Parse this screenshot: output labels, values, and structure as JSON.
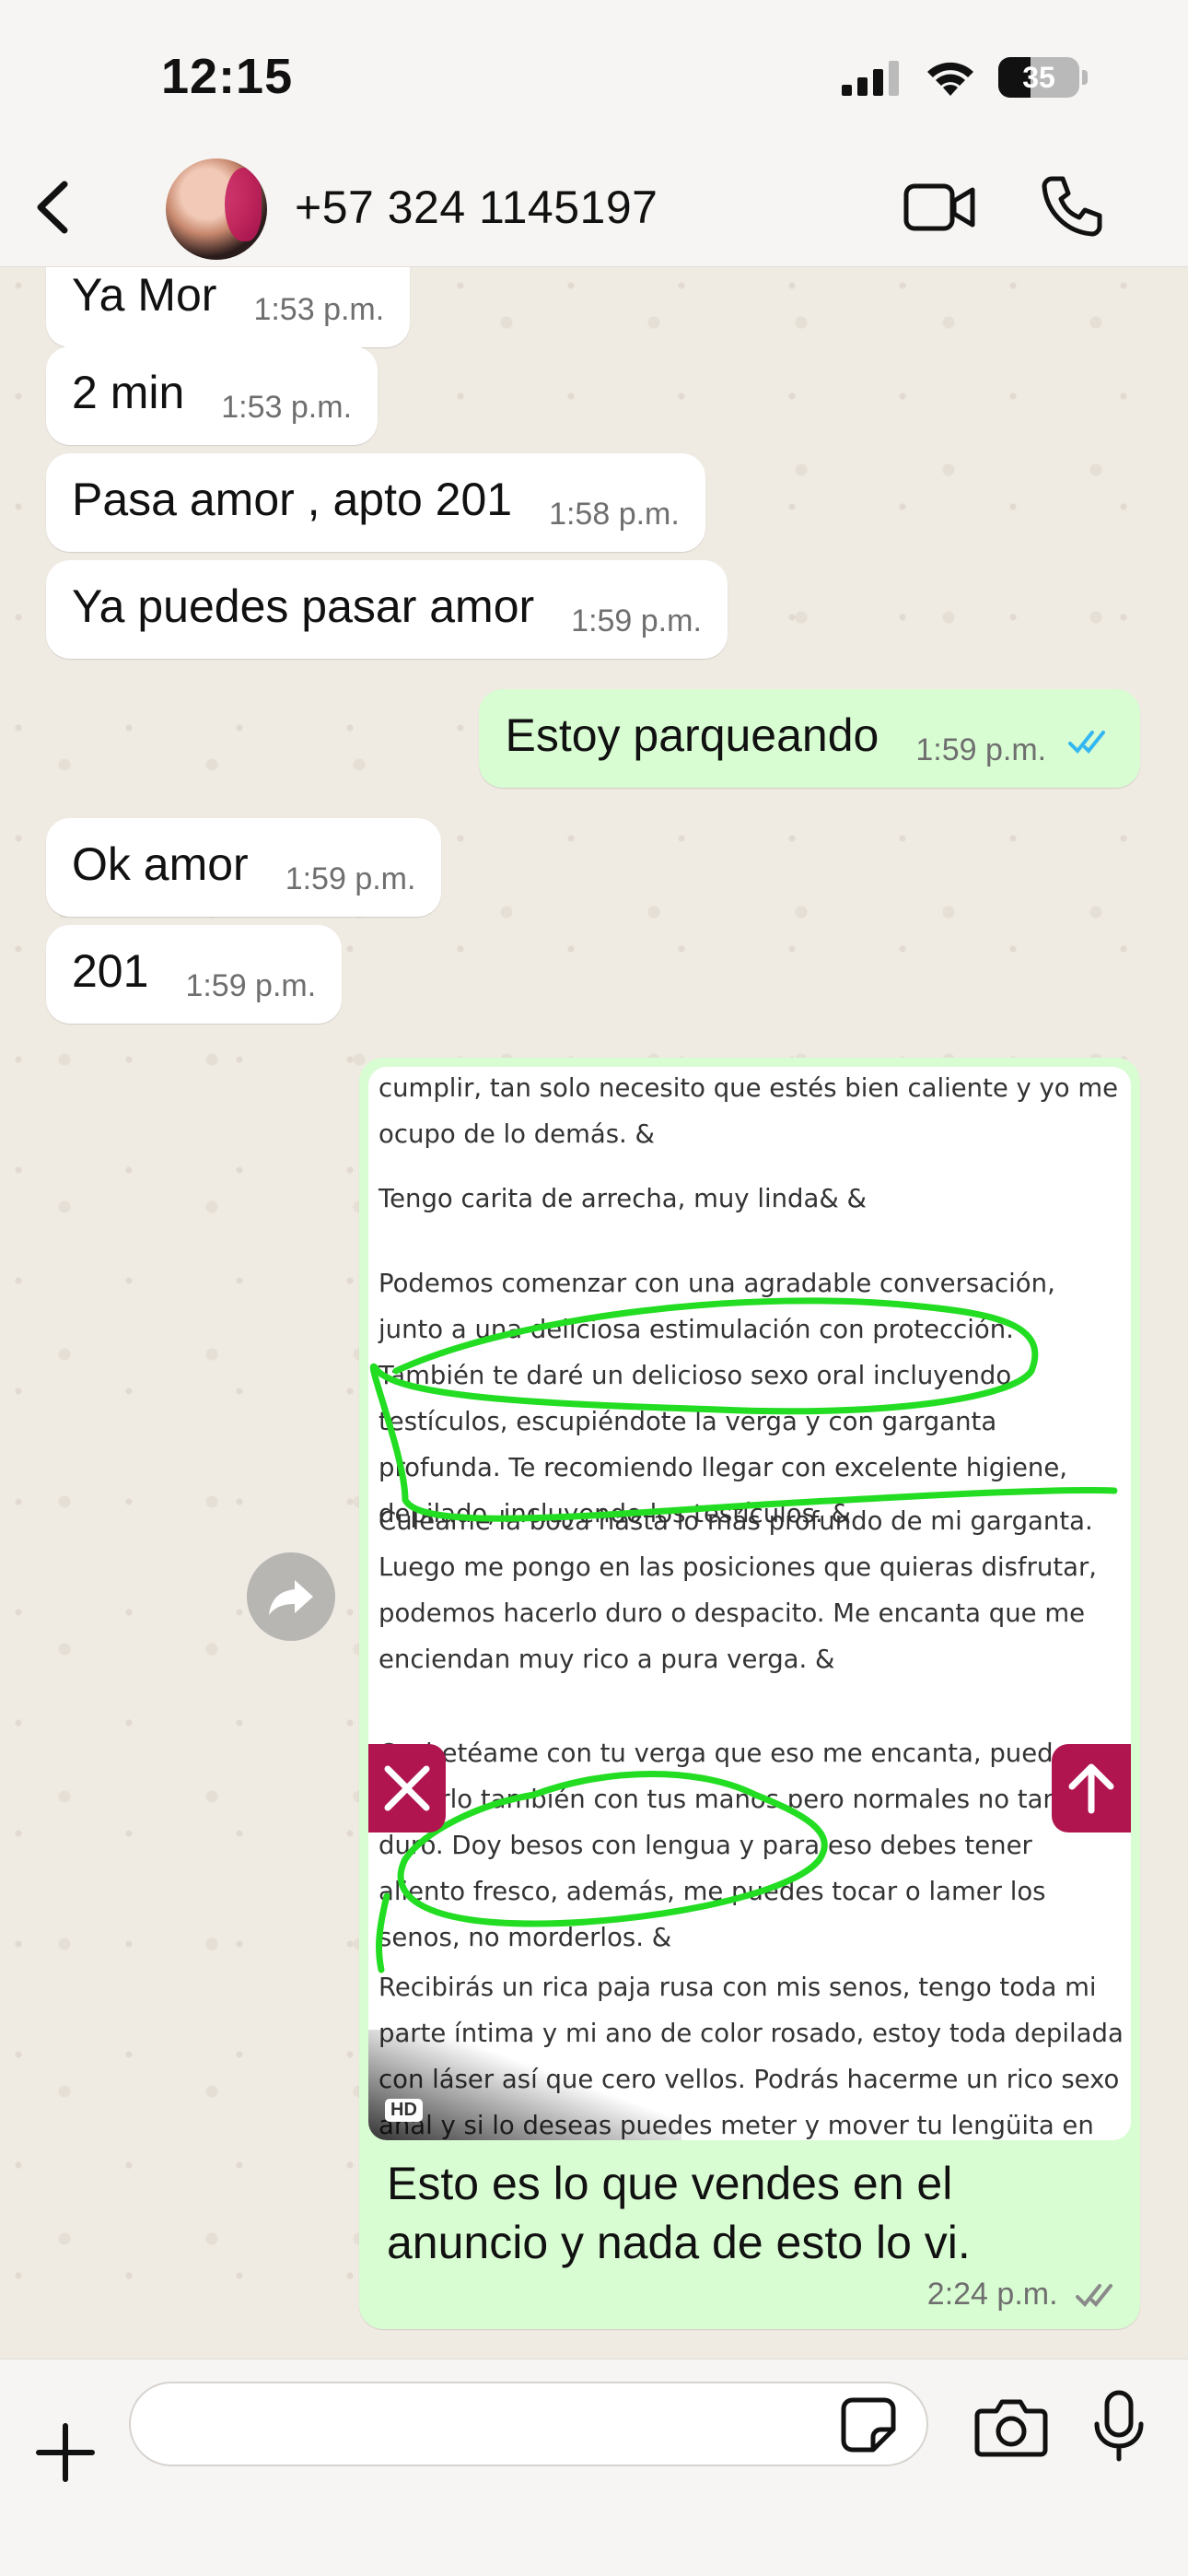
{
  "status_bar": {
    "time": "12:15",
    "battery": "35"
  },
  "header": {
    "contact": "+57 324 1145197"
  },
  "messages": [
    {
      "text": "Ya Mor",
      "time": "1:53 p.m."
    },
    {
      "text": "2 min",
      "time": "1:53 p.m."
    },
    {
      "text": "Pasa amor , apto 201",
      "time": "1:58 p.m."
    },
    {
      "text": "Ya puedes pasar amor",
      "time": "1:59 p.m."
    },
    {
      "text": "Estoy parqueando",
      "time": "1:59 p.m."
    },
    {
      "text": "Ok amor",
      "time": "1:59 p.m."
    },
    {
      "text": "201",
      "time": "1:59 p.m."
    }
  ],
  "media_message": {
    "image_lines": [
      "cumplir, tan solo necesito que estés bien caliente y yo me ocupo de lo demás. &",
      "Tengo carita de arrecha, muy linda& &",
      "Podemos comenzar con una agradable conversación, junto a una deliciosa estimulación con protección. También te daré un delicioso sexo oral incluyendo testículos, escupiéndote la verga y con garganta profunda. Te recomiendo llegar con excelente higiene, depilado, incluyendo los testículos. &",
      "Culéame la boca hasta lo más profundo de mi garganta. Luego me pongo en las posiciones que quieras disfrutar, podemos hacerlo duro o despacito. Me encanta que me enciendan muy rico a pura verga. &",
      "Cachetéame con tu verga que eso me encanta, puedes hacerlo también con tus manos pero normales no tan duro. Doy besos con lengua y para eso debes tener aliento fresco, además, me puedes tocar o lamer los senos, no morderlos. &",
      "Recibirás un rica paja rusa con mis senos, tengo toda mi parte íntima y mi ano de color rosado, estoy toda depilada con láser así que cero vellos. Podrás hacerme un rico sexo anal y si lo deseas puedes meter y mover tu lengüita en mi"
    ],
    "hd_badge": "HD",
    "caption": "Esto es lo que vendes en el anuncio y nada de esto lo vi.",
    "time": "2:24 p.m."
  },
  "composer": {
    "placeholder": ""
  },
  "colors": {
    "incoming": "#ffffff",
    "outgoing": "#d9fdd3",
    "read_ticks": "#34b7f1",
    "sent_ticks": "#8a8a8a",
    "scribble": "#22dd22",
    "image_buttons": "#b0154f"
  }
}
